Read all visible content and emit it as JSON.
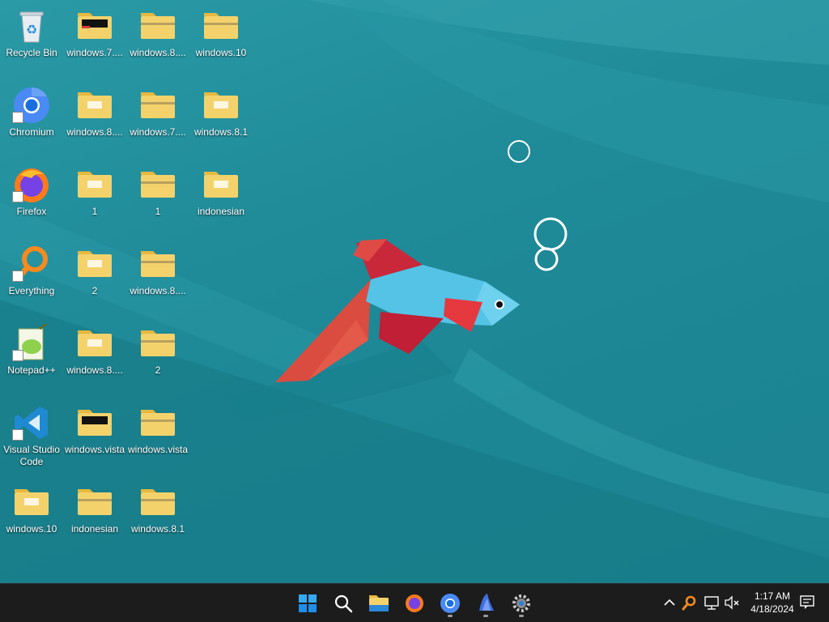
{
  "desktop_icons": [
    {
      "label": "Recycle Bin",
      "icon": "recycle-bin-icon"
    },
    {
      "label": "windows.7....",
      "icon": "folder-icon"
    },
    {
      "label": "windows.8....",
      "icon": "zip-folder-icon"
    },
    {
      "label": "windows.10",
      "icon": "zip-folder-icon"
    },
    {
      "label": "Chromium",
      "icon": "chromium-icon"
    },
    {
      "label": "windows.8....",
      "icon": "folder-icon"
    },
    {
      "label": "windows.7....",
      "icon": "zip-folder-icon"
    },
    {
      "label": "windows.8.1",
      "icon": "folder-icon"
    },
    {
      "label": "Firefox",
      "icon": "firefox-icon"
    },
    {
      "label": "1",
      "icon": "folder-icon"
    },
    {
      "label": "1",
      "icon": "zip-folder-icon"
    },
    {
      "label": "indonesian",
      "icon": "folder-icon"
    },
    {
      "label": "Everything",
      "icon": "everything-search-icon"
    },
    {
      "label": "2",
      "icon": "folder-icon"
    },
    {
      "label": "windows.8....",
      "icon": "zip-folder-icon"
    },
    {
      "label": "Notepad++",
      "icon": "notepadpp-icon"
    },
    {
      "label": "windows.8....",
      "icon": "folder-icon"
    },
    {
      "label": "2",
      "icon": "zip-folder-icon"
    },
    {
      "label": "Visual Studio Code",
      "icon": "vscode-icon"
    },
    {
      "label": "windows.vista",
      "icon": "folder-icon"
    },
    {
      "label": "windows.vista",
      "icon": "zip-folder-icon"
    },
    {
      "label": "windows.10",
      "icon": "folder-icon"
    },
    {
      "label": "indonesian",
      "icon": "zip-folder-icon"
    },
    {
      "label": "windows.8.1",
      "icon": "zip-folder-icon"
    }
  ],
  "taskbar": {
    "apps": [
      "start-icon",
      "search-icon",
      "file-explorer-icon",
      "firefox-icon",
      "chromium-icon",
      "fish-app-icon",
      "settings-icon"
    ],
    "tray": [
      "chevron-up-icon",
      "everything-search-icon",
      "network-icon",
      "volume-muted-icon"
    ],
    "clock": {
      "time": "1:17 AM",
      "date": "4/18/2024"
    },
    "notifications": "notification-icon"
  },
  "colors": {
    "wallpaper": "#1f8a98",
    "taskbar": "#1c1c1c",
    "folder": "#f4d26b",
    "accent": "#0078d4"
  }
}
